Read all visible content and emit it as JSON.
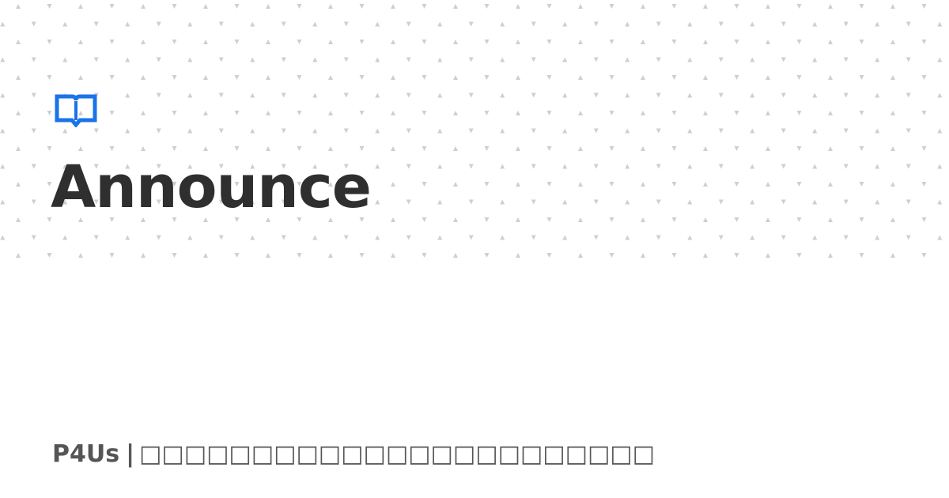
{
  "page": {
    "title": "Announce",
    "site_name": "P4Us",
    "separator": "|",
    "site_tagline": "□□□□□□□□□□□□□□□□□□□□□□□"
  },
  "icons": {
    "logo": "open-book-icon"
  },
  "colors": {
    "accent": "#1a73e8",
    "title_text": "#2f2f2f",
    "footer_text": "#555555",
    "pattern_dot": "#cfcfcf",
    "background": "#ffffff"
  }
}
